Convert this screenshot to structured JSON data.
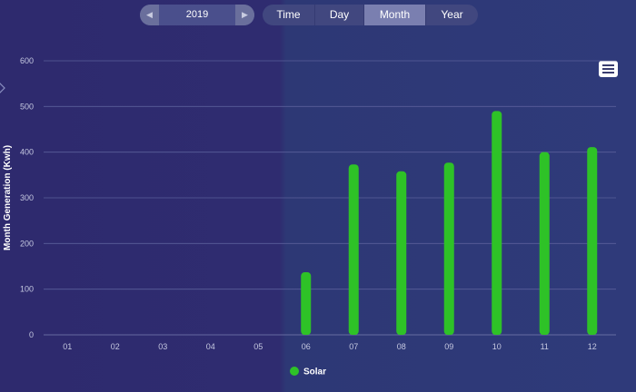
{
  "year_selector": {
    "prev_icon": "chevron-left-bar-icon",
    "year": "2019",
    "next_icon": "chevron-right-bar-icon"
  },
  "mode_tabs": [
    {
      "label": "Time",
      "active": false
    },
    {
      "label": "Day",
      "active": false
    },
    {
      "label": "Month",
      "active": true
    },
    {
      "label": "Year",
      "active": false
    }
  ],
  "menu_icon": "hamburger-menu-icon",
  "colors": {
    "series": "#2ec227",
    "grid": "#5a5f9a",
    "tab_active": "#7a7fb0"
  },
  "chart_data": {
    "type": "bar",
    "title": "",
    "xlabel": "",
    "ylabel": "Month Generation (Kwh)",
    "categories": [
      "01",
      "02",
      "03",
      "04",
      "05",
      "06",
      "07",
      "08",
      "09",
      "10",
      "11",
      "12"
    ],
    "series": [
      {
        "name": "Solar",
        "values": [
          0,
          0,
          0,
          0,
          0,
          137,
          373,
          358,
          377,
          490,
          400,
          411
        ]
      }
    ],
    "ylim": [
      0,
      600
    ],
    "yticks": [
      "0",
      "100",
      "200",
      "300",
      "400",
      "500",
      "600"
    ],
    "grid": true,
    "legend_position": "bottom"
  }
}
